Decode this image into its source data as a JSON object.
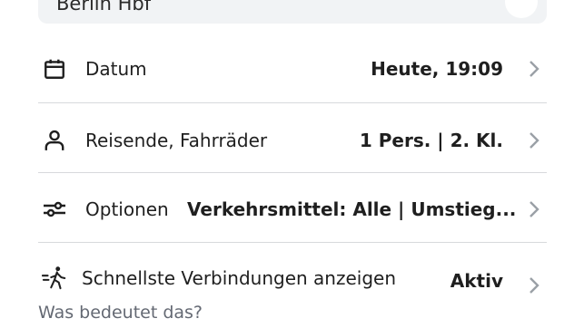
{
  "from": {
    "station": "Berlin Hbf"
  },
  "rows": [
    {
      "icon": "calendar-icon",
      "label": "Datum",
      "value": "Heute, 19:09"
    },
    {
      "icon": "person-icon",
      "label": "Reisende, Fahrräder",
      "value": "1 Pers. | 2. Kl."
    },
    {
      "icon": "sliders-icon",
      "label": "Optionen",
      "value": "Verkehrsmittel: Alle | Umstieg..."
    },
    {
      "icon": "walking-person-icon",
      "label": "Schnellste Verbindungen anzeigen",
      "value": "Aktiv"
    }
  ],
  "help_link": "Was bedeutet das?",
  "colors": {
    "divider": "#d7d9dc",
    "chevron": "#9aa0a6",
    "secondary_text": "#646973",
    "input_bg": "#f1f3f5"
  }
}
